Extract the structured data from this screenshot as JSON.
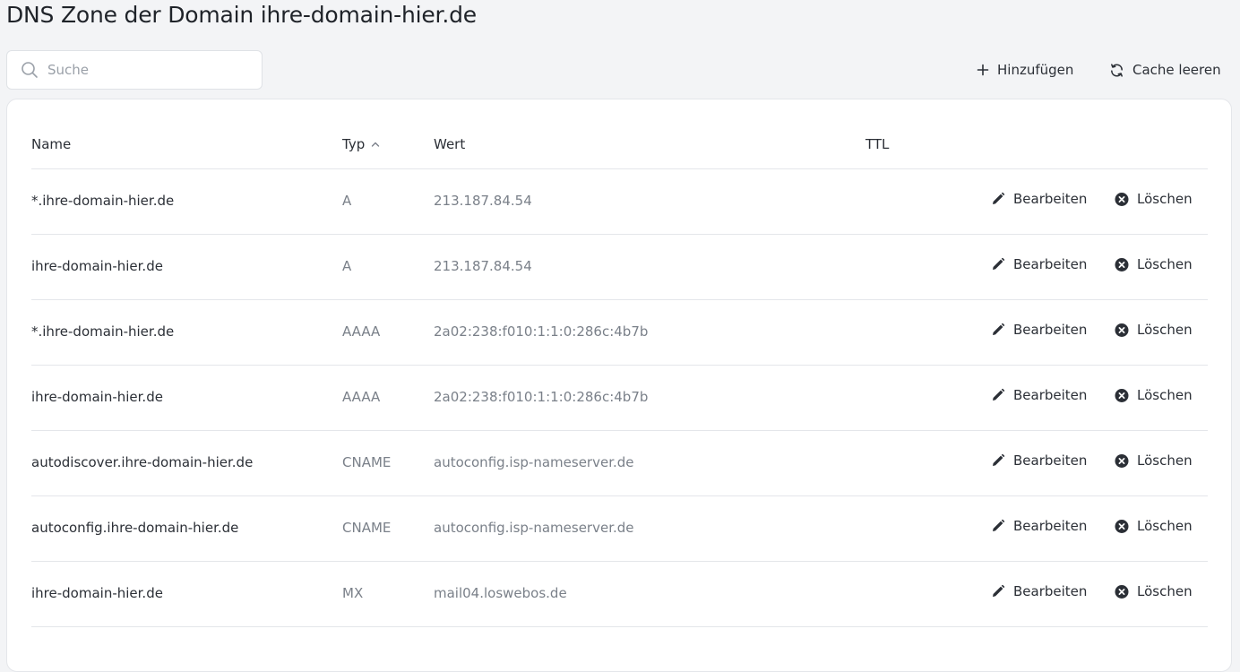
{
  "page": {
    "title": "DNS Zone der Domain ihre-domain-hier.de"
  },
  "search": {
    "placeholder": "Suche",
    "value": ""
  },
  "toolbar": {
    "add_label": "Hinzufügen",
    "cache_label": "Cache leeren"
  },
  "table": {
    "headers": {
      "name": "Name",
      "type": "Typ",
      "value": "Wert",
      "ttl": "TTL"
    },
    "sort": {
      "column": "Typ",
      "direction": "ascending"
    },
    "action_labels": {
      "edit": "Bearbeiten",
      "delete": "Löschen"
    },
    "rows": [
      {
        "name": "*.ihre-domain-hier.de",
        "type": "A",
        "value": "213.187.84.54",
        "ttl": ""
      },
      {
        "name": "ihre-domain-hier.de",
        "type": "A",
        "value": "213.187.84.54",
        "ttl": ""
      },
      {
        "name": "*.ihre-domain-hier.de",
        "type": "AAAA",
        "value": "2a02:238:f010:1:1:0:286c:4b7b",
        "ttl": ""
      },
      {
        "name": "ihre-domain-hier.de",
        "type": "AAAA",
        "value": "2a02:238:f010:1:1:0:286c:4b7b",
        "ttl": ""
      },
      {
        "name": "autodiscover.ihre-domain-hier.de",
        "type": "CNAME",
        "value": "autoconfig.isp-nameserver.de",
        "ttl": ""
      },
      {
        "name": "autoconfig.ihre-domain-hier.de",
        "type": "CNAME",
        "value": "autoconfig.isp-nameserver.de",
        "ttl": ""
      },
      {
        "name": "ihre-domain-hier.de",
        "type": "MX",
        "value": "mail04.loswebos.de",
        "ttl": ""
      }
    ]
  },
  "icons": {
    "search": "search-icon",
    "add": "plus-icon",
    "cache": "refresh-icon",
    "sort": "chevron-up-icon",
    "edit": "pencil-icon",
    "delete": "close-circle-icon"
  },
  "colors": {
    "background": "#f3f4f6",
    "card": "#ffffff",
    "text": "#2b2f36",
    "muted": "#7a8089",
    "border": "#e4e6ea"
  }
}
